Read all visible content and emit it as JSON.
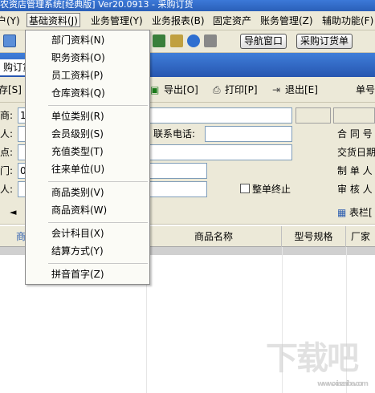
{
  "window": {
    "title": "农资店管理系统[经典版] Ver20.0913 - 采购订货"
  },
  "menu": {
    "items": [
      {
        "label": "户(Y)"
      },
      {
        "label": "基础资料(J)"
      },
      {
        "label": "业务管理(Y)"
      },
      {
        "label": "业务报表(B)"
      },
      {
        "label": "固定资产"
      },
      {
        "label": "账务管理(Z)"
      },
      {
        "label": "辅助功能(F)"
      }
    ]
  },
  "toolbar": {
    "nav_button": "导航窗口",
    "purchase_button": "采购订货单"
  },
  "tabs": {
    "active": "购订货"
  },
  "form_toolbar": {
    "save": "存[S]",
    "export": "导出[O]",
    "print": "打印[P]",
    "exit": "退出[E]",
    "doc_no_label": "单号"
  },
  "form": {
    "supplier_label": "商:",
    "supplier_value": "1",
    "person_label": "人:",
    "phone_label": "联系电话:",
    "contract_label": "合 同 号",
    "store_label": "点:",
    "delivery_label": "交货日期",
    "dept_label": "门:",
    "dept_value": "0",
    "maker_label": "制 单 人",
    "handler_label": "人:",
    "close_label": "整单终止",
    "auditor_label": "审 核 人"
  },
  "grid_toolbar": {
    "arrow": "◄",
    "header_bar": "表栏["
  },
  "grid": {
    "columns": [
      "商",
      "商品名称",
      "型号规格",
      "厂家"
    ]
  },
  "dropdown": {
    "items": [
      "部门资料(N)",
      "职务资料(O)",
      "员工资料(P)",
      "仓库资料(Q)",
      "单位类别(R)",
      "会员级别(S)",
      "充值类型(T)",
      "往来单位(U)",
      "商品类别(V)",
      "商品资料(W)",
      "会计科目(X)",
      "结算方式(Y)",
      "拼音首字(Z)"
    ]
  },
  "watermark": {
    "text": "下载吧",
    "url": "www.xiazaiba.com"
  },
  "colors": {
    "title_blue": "#2a5fb8",
    "chrome": "#ece9d8"
  }
}
